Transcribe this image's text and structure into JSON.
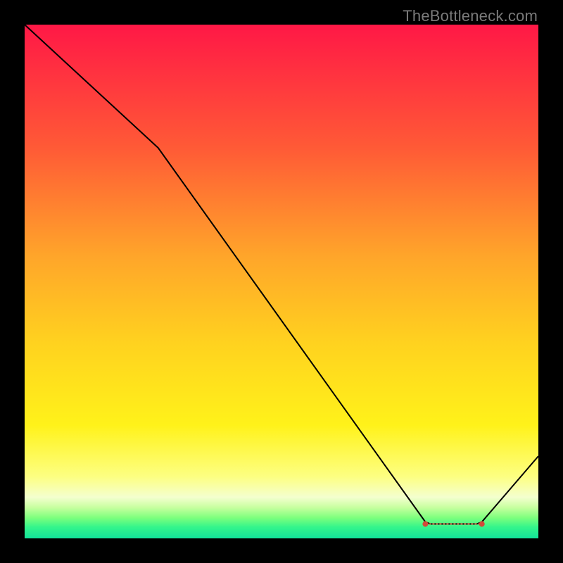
{
  "watermark": "TheBottleneck.com",
  "chart_data": {
    "type": "line",
    "title": "",
    "xlabel": "",
    "ylabel": "",
    "xlim": [
      0,
      100
    ],
    "ylim": [
      0,
      100
    ],
    "grid": false,
    "background": "gradient red→yellow→green (vertical)",
    "series": [
      {
        "name": "curve",
        "color": "#000000",
        "x": [
          0,
          26,
          78,
          79,
          88,
          89,
          100
        ],
        "values": [
          100,
          76,
          3.2,
          2.8,
          2.8,
          3.2,
          16
        ]
      },
      {
        "name": "flat-zone-marker",
        "color": "#d24a3a",
        "style": "dashed",
        "x": [
          78,
          89
        ],
        "values": [
          2.8,
          2.8
        ]
      }
    ],
    "gradient_stops": [
      {
        "pos": 0.0,
        "color": "#ff1846"
      },
      {
        "pos": 0.24,
        "color": "#ff5a36"
      },
      {
        "pos": 0.45,
        "color": "#ffa52a"
      },
      {
        "pos": 0.62,
        "color": "#ffd21f"
      },
      {
        "pos": 0.78,
        "color": "#fff21a"
      },
      {
        "pos": 0.88,
        "color": "#fdff82"
      },
      {
        "pos": 0.92,
        "color": "#f4ffcf"
      },
      {
        "pos": 0.94,
        "color": "#c7ff9f"
      },
      {
        "pos": 0.96,
        "color": "#7dff7d"
      },
      {
        "pos": 0.978,
        "color": "#34f58b"
      },
      {
        "pos": 1.0,
        "color": "#12e39a"
      }
    ]
  }
}
